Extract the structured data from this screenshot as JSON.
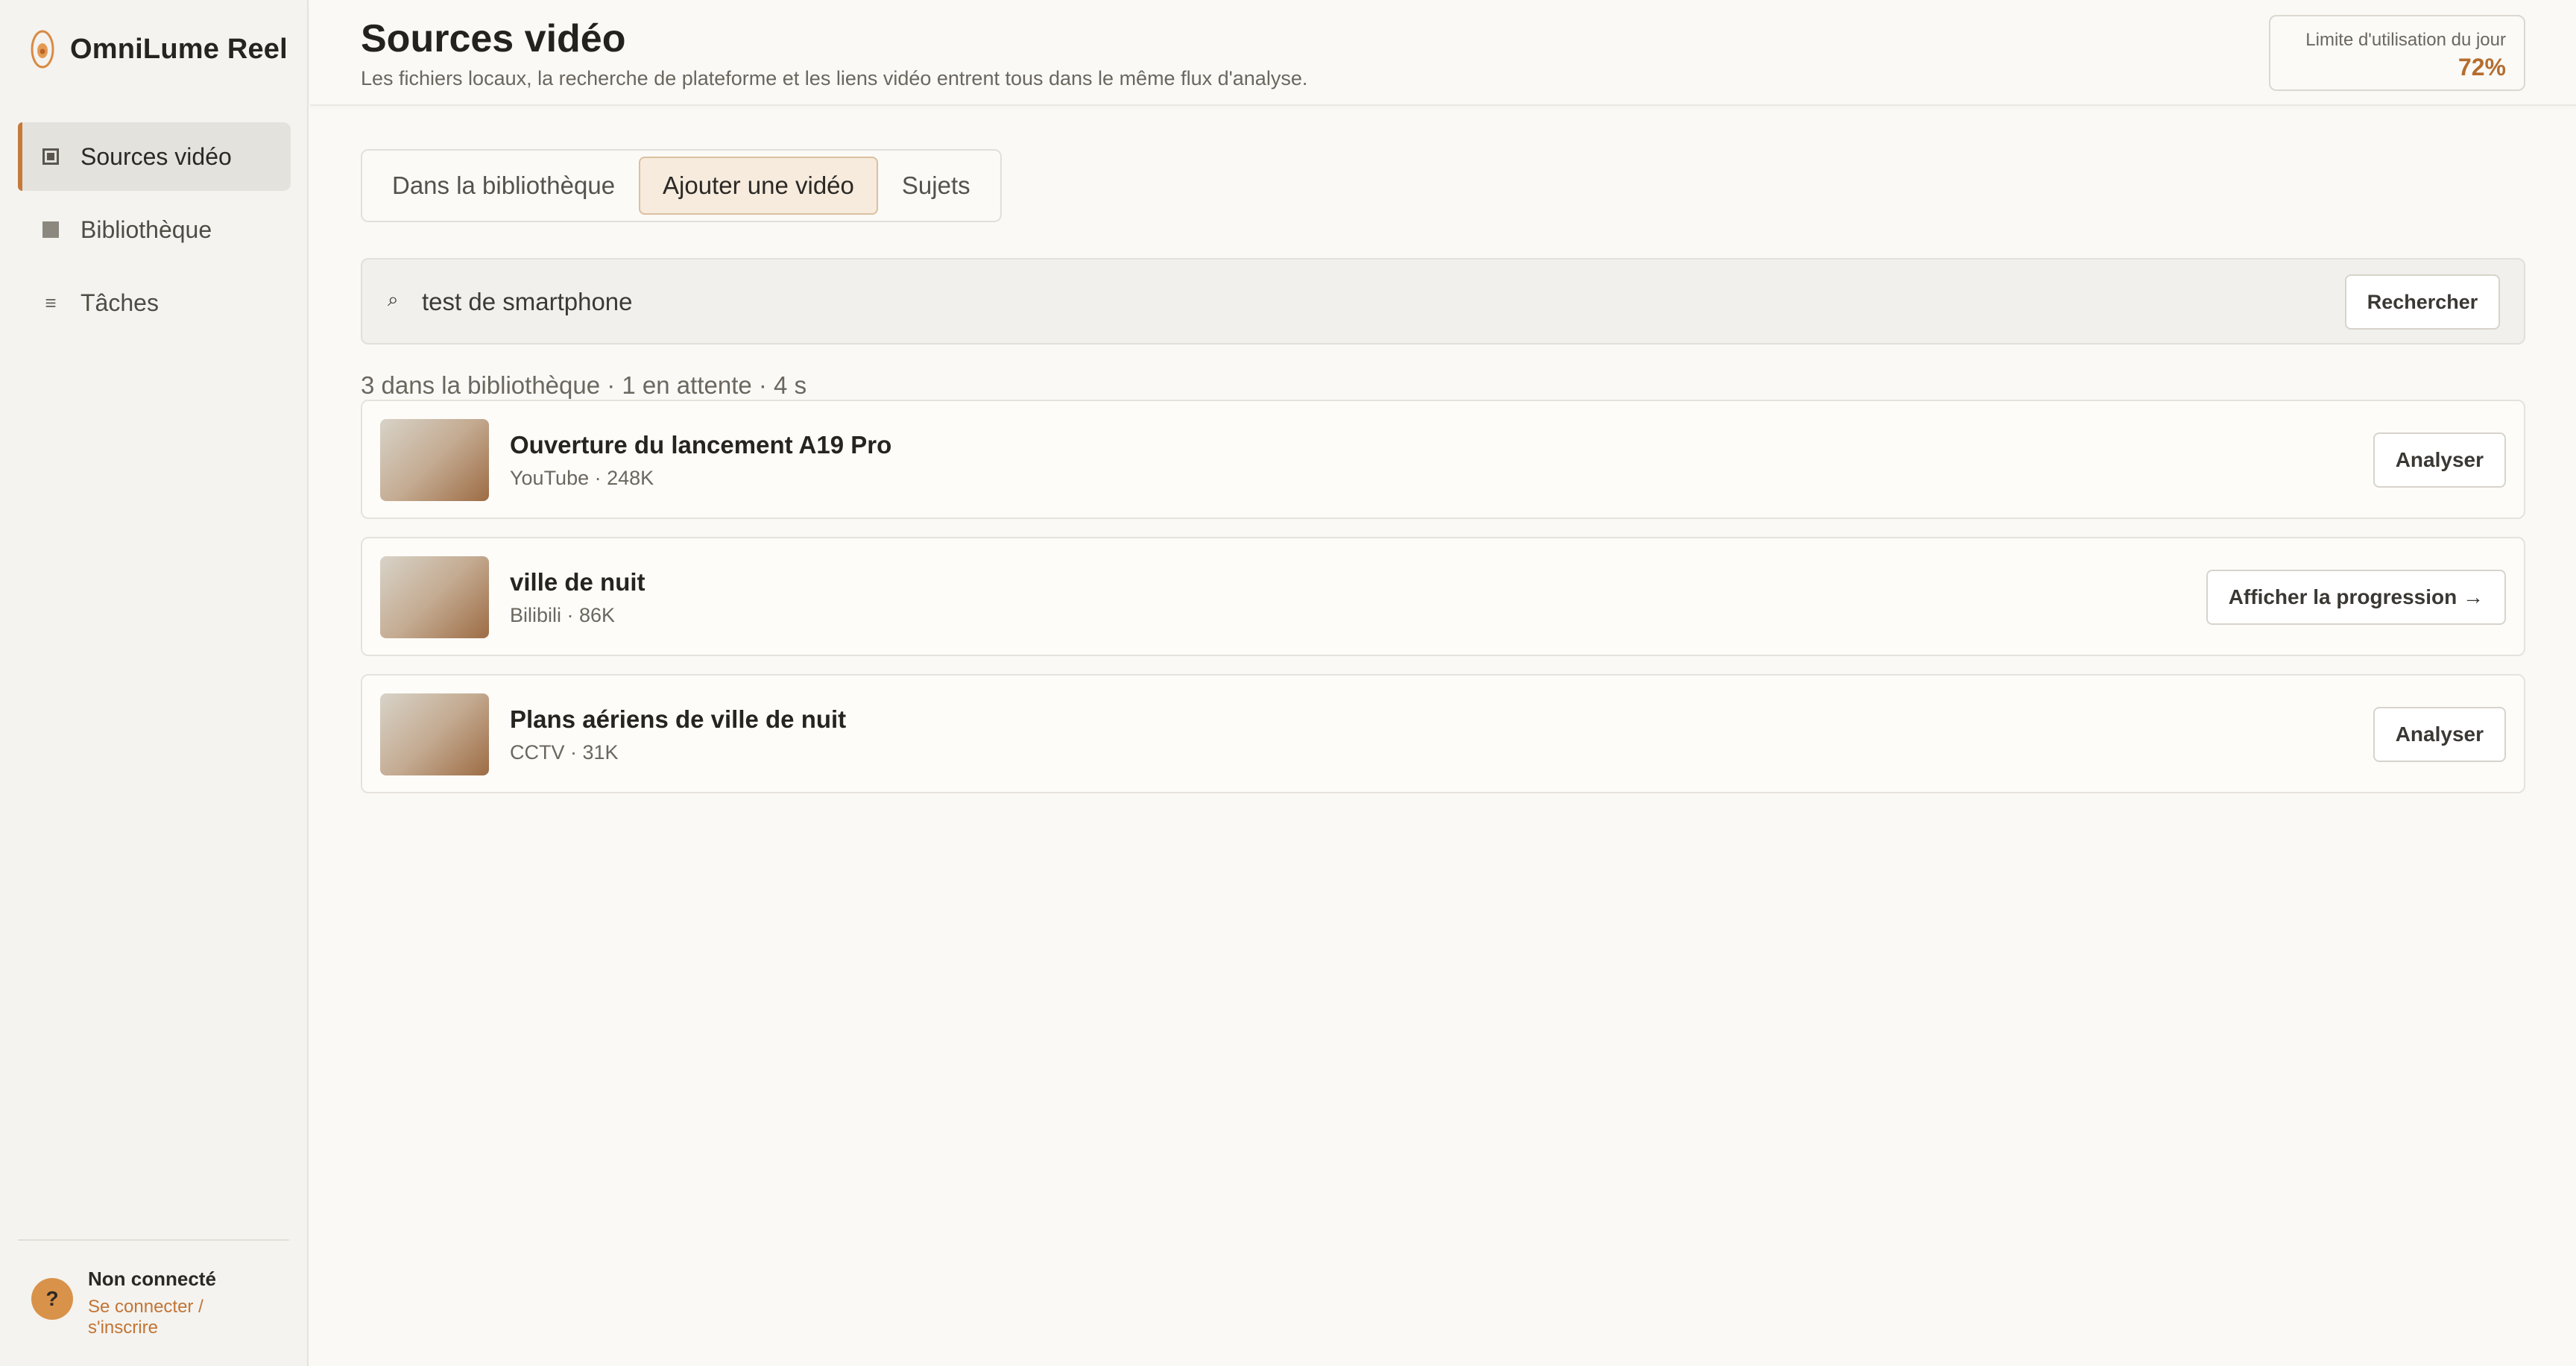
{
  "app": {
    "name": "OmniLume Reel",
    "logo_icon": "flame-icon",
    "accent_color": "#c57a3c"
  },
  "sidebar": {
    "items": [
      {
        "label": "Sources vidéo",
        "icon": "video-frame-icon",
        "active": true
      },
      {
        "label": "Bibliothèque",
        "icon": "library-square-icon",
        "active": false
      },
      {
        "label": "Tâches",
        "icon": "list-icon",
        "active": false
      }
    ],
    "account": {
      "avatar_glyph": "?",
      "status": "Non connecté",
      "link": "Se connecter / s'inscrire"
    }
  },
  "header": {
    "title": "Sources vidéo",
    "subtitle": "Les fichiers locaux, la recherche de plateforme et les liens vidéo entrent tous dans le même flux d'analyse.",
    "quota_label": "Limite d'utilisation du jour",
    "quota_value": "72%"
  },
  "tabs": [
    {
      "label": "Dans la bibliothèque",
      "active": false
    },
    {
      "label": "Ajouter une vidéo",
      "active": true
    },
    {
      "label": "Sujets",
      "active": false
    }
  ],
  "search": {
    "icon": "search-icon",
    "value": "test de smartphone",
    "button_label": "Rechercher"
  },
  "summary": "3 dans la bibliothèque · 1 en attente · 4 s",
  "videos": [
    {
      "title": "Ouverture du lancement A19 Pro",
      "meta": "YouTube · 248K",
      "action": "Analyser"
    },
    {
      "title": "ville de nuit",
      "meta": "Bilibili · 86K",
      "action": "Afficher la progression →"
    },
    {
      "title": "Plans aériens de ville de nuit",
      "meta": "CCTV · 31K",
      "action": "Analyser"
    }
  ]
}
